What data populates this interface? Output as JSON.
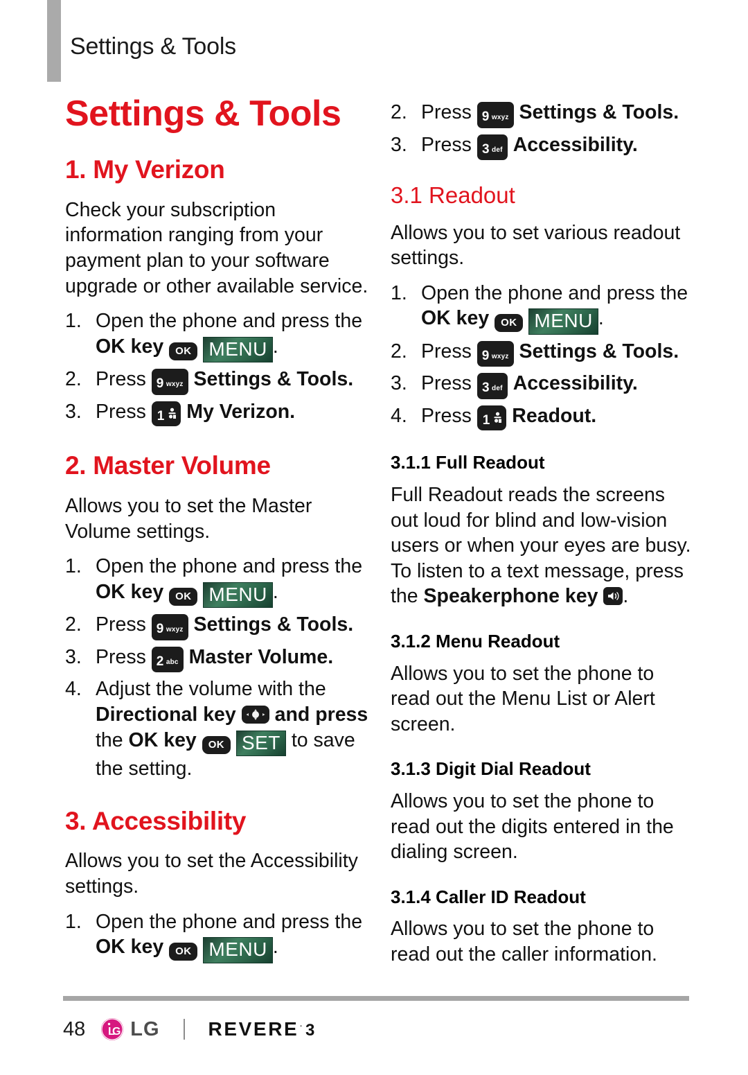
{
  "header": {
    "running_title": "Settings & Tools"
  },
  "chapter": {
    "title": "Settings & Tools"
  },
  "colors": {
    "accent_red": "#e1141e",
    "softkey_green": "#2f6a4e",
    "keycap_black": "#1c1c1c",
    "rule_gray": "#a6a6a6",
    "lg_magenta": "#d6187f"
  },
  "keys": {
    "ok": "OK",
    "menu_label": "MENU",
    "set_label": "SET",
    "nine": "9",
    "nine_letters": "wxyz",
    "three": "3",
    "three_letters": "def",
    "two": "2",
    "two_letters": "abc",
    "one": "1",
    "directional_name": "directional-key",
    "speakerphone_name": "speakerphone-key"
  },
  "left_column": {
    "sections": [
      {
        "heading": "1. My Verizon",
        "intro": "Check your subscription information ranging from your payment plan to your software upgrade or other available service.",
        "steps": [
          {
            "num": "1.",
            "prefix": "Open the phone and press the ",
            "bold": "OK key",
            "keys": "ok+menu",
            "suffix": "."
          },
          {
            "num": "2.",
            "prefix": "Press ",
            "keys": "nine",
            "bold": "Settings & Tools",
            "suffix": "."
          },
          {
            "num": "3.",
            "prefix": "Press ",
            "keys": "one",
            "bold": "My Verizon",
            "suffix": "."
          }
        ]
      },
      {
        "heading": "2. Master Volume",
        "intro": "Allows you to set the Master Volume settings.",
        "steps": [
          {
            "num": "1.",
            "prefix": "Open the phone and press the ",
            "bold": "OK key",
            "keys": "ok+menu",
            "suffix": "."
          },
          {
            "num": "2.",
            "prefix": "Press ",
            "keys": "nine",
            "bold": "Settings & Tools",
            "suffix": "."
          },
          {
            "num": "3.",
            "prefix": "Press ",
            "keys": "two",
            "bold": "Master Volume",
            "suffix": "."
          },
          {
            "num": "4.",
            "text": "Adjust the volume with the Directional key and press the OK key SET to save the setting."
          }
        ]
      },
      {
        "heading": "3. Accessibility",
        "intro": "Allows you to set the Accessibility settings.",
        "steps": [
          {
            "num": "1.",
            "prefix": "Open the phone and press the ",
            "bold": "OK key",
            "keys": "ok+menu",
            "suffix": "."
          }
        ]
      }
    ],
    "step4_parts": {
      "a": "Adjust the volume with the ",
      "b_bold": "Directional key",
      "c": " and press ",
      "d": "the ",
      "e_bold": "OK key",
      "f": " to save ",
      "g": "the setting."
    }
  },
  "right_column": {
    "continued_steps": [
      {
        "num": "2.",
        "prefix": "Press ",
        "keys": "nine",
        "bold": "Settings & Tools",
        "suffix": "."
      },
      {
        "num": "3.",
        "prefix": "Press ",
        "keys": "three",
        "bold": "Accessibility",
        "suffix": "."
      }
    ],
    "readout": {
      "heading": "3.1 Readout",
      "intro": "Allows you to set various readout settings.",
      "steps": [
        {
          "num": "1.",
          "prefix": "Open the phone and press the ",
          "bold": "OK key",
          "keys": "ok+menu",
          "suffix": "."
        },
        {
          "num": "2.",
          "prefix": "Press ",
          "keys": "nine",
          "bold": "Settings & Tools",
          "suffix": "."
        },
        {
          "num": "3.",
          "prefix": "Press ",
          "keys": "three",
          "bold": "Accessibility",
          "suffix": "."
        },
        {
          "num": "4.",
          "prefix": "Press ",
          "keys": "one",
          "bold": "Readout",
          "suffix": "."
        }
      ]
    },
    "subsections": [
      {
        "heading": "3.1.1 Full Readout",
        "body_a": "Full Readout reads the screens out loud for blind and low-vision users or when your eyes are busy. To listen to a text message, press the ",
        "body_bold": "Speakerphone key",
        "body_b": "."
      },
      {
        "heading": "3.1.2 Menu Readout",
        "body": "Allows you to set the phone to read out the Menu List or Alert screen."
      },
      {
        "heading": "3.1.3 Digit Dial Readout",
        "body": "Allows you to set the phone to read out the digits entered in the dialing screen."
      },
      {
        "heading": "3.1.4 Caller ID Readout",
        "body": "Allows you to set the phone to read out the caller information."
      }
    ]
  },
  "footer": {
    "page_number": "48",
    "brand": "LG",
    "model": "REVERE",
    "model_sup": "·",
    "model_version": "3"
  }
}
